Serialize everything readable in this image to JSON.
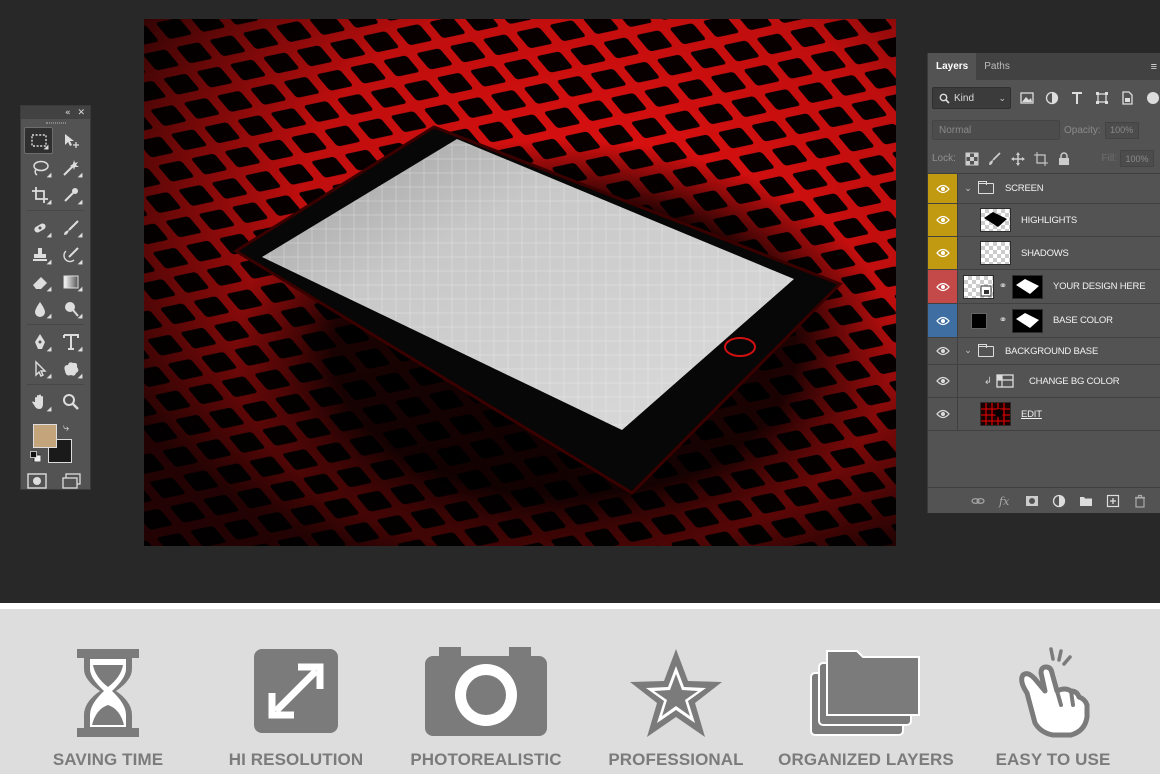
{
  "layers_panel": {
    "tabs": [
      {
        "label": "Layers",
        "active": true
      },
      {
        "label": "Paths",
        "active": false
      }
    ],
    "menu_icon": "≡",
    "filter_kind": "Kind",
    "blend_mode": "Normal",
    "opacity_label": "Opacity:",
    "opacity_value": "100%",
    "lock_label": "Lock:",
    "fill_label": "Fill:",
    "fill_value": "100%",
    "layers": [
      {
        "name": "SCREEN",
        "type": "group",
        "label_color": "#c29a12"
      },
      {
        "name": "HIGHLIGHTS",
        "type": "layer",
        "label_color": "#c29a12"
      },
      {
        "name": "SHADOWS",
        "type": "layer",
        "label_color": "#c29a12"
      },
      {
        "name": "YOUR DESIGN HERE",
        "type": "smart-object",
        "label_color": "#c44a4a"
      },
      {
        "name": "BASE COLOR",
        "type": "fill",
        "label_color": "#3f6ea3"
      },
      {
        "name": "BACKGROUND BASE",
        "type": "group",
        "label_color": ""
      },
      {
        "name": "CHANGE BG COLOR",
        "type": "adjustment",
        "label_color": ""
      },
      {
        "name": "EDIT",
        "type": "smart-object",
        "label_color": ""
      }
    ]
  },
  "tools_panel": {
    "collapse_icon": "«",
    "close_icon": "✕",
    "foreground_color": "#c4a57b",
    "background_color": "#1a1a1a",
    "swap_icon": "⤷"
  },
  "features": [
    {
      "label": "SAVING TIME",
      "icon": "hourglass-icon"
    },
    {
      "label": "HI RESOLUTION",
      "icon": "expand-arrows-icon"
    },
    {
      "label": "PHOTOREALISTIC",
      "icon": "camera-icon"
    },
    {
      "label": "PROFESSIONAL",
      "icon": "star-icon"
    },
    {
      "label": "ORGANIZED LAYERS",
      "icon": "folders-icon"
    },
    {
      "label": "EASY TO USE",
      "icon": "tapping-hand-icon"
    }
  ],
  "colors": {
    "canvas_accent": "#e01010",
    "feature_icon": "#7b7b7b",
    "feature_bg": "#dddddd",
    "panel_bg": "#535353",
    "workspace_bg": "#282828"
  }
}
